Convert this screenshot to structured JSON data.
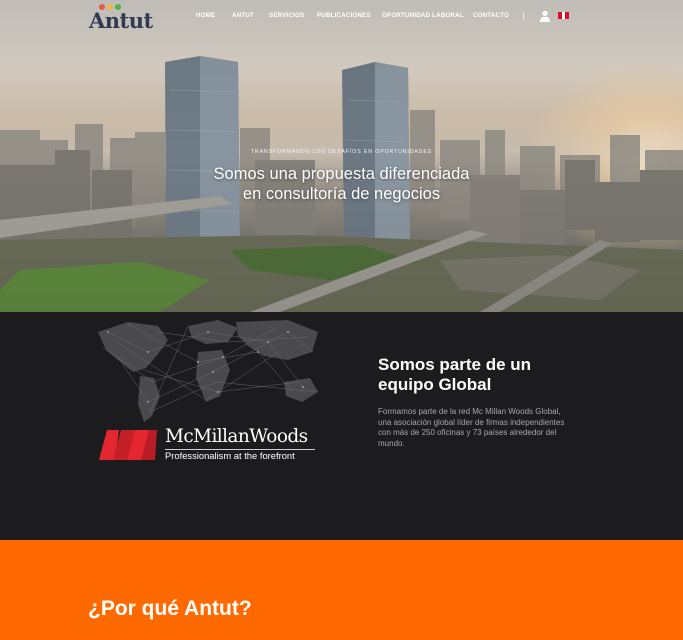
{
  "brand": {
    "name": "Antut",
    "dot_colors": [
      "#e8574b",
      "#f2b63c",
      "#4caf50"
    ],
    "text_color": "#2e3b52"
  },
  "nav": {
    "links": [
      "HOME",
      "ANTUT",
      "SERVICIOS",
      "PUBLICACIONES",
      "OPORTUNIDAD LABORAL",
      "CONTACTO"
    ],
    "user_icon": "user-icon",
    "flag": {
      "name": "peru-flag-icon",
      "colors": [
        "#d91023",
        "#ffffff",
        "#d91023"
      ]
    }
  },
  "hero": {
    "kicker": "TRANSFORMANDO LOS DESAFÍOS EN OPORTUNIDADES",
    "title": "Somos una propuesta diferenciada en consultoría de negocios"
  },
  "global": {
    "title": "Somos parte de un equipo Global",
    "text": "Formamos parte de la red Mc Millan Woods Global, una asociación global líder de firmas independientes con más de 250 oficinas y 73 países alrededor del mundo.",
    "partner": {
      "name": "McMillanWoods",
      "tagline": "Professionalism at the forefront",
      "accent": "#e3262f"
    }
  },
  "why": {
    "title": "¿Por qué Antut?",
    "background": "#ff6a00"
  }
}
